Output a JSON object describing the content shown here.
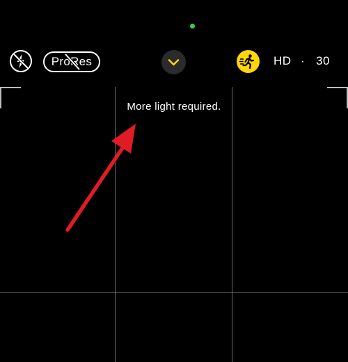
{
  "status": {
    "indicator_color": "#30d158"
  },
  "top_bar": {
    "flash": {
      "icon": "flash-off-icon",
      "state": "off"
    },
    "prores": {
      "label": "ProRes",
      "state": "off"
    },
    "controls_toggle": {
      "icon": "chevron-down-icon"
    },
    "action_mode": {
      "icon": "running-figure-icon",
      "state": "on",
      "color": "#ffd60a"
    },
    "resolution": "HD",
    "separator": "·",
    "frame_rate": "30"
  },
  "viewfinder": {
    "message": "More light required.",
    "grid": "on",
    "annotation": {
      "icon": "red-arrow-icon",
      "color": "#e01b24"
    }
  }
}
